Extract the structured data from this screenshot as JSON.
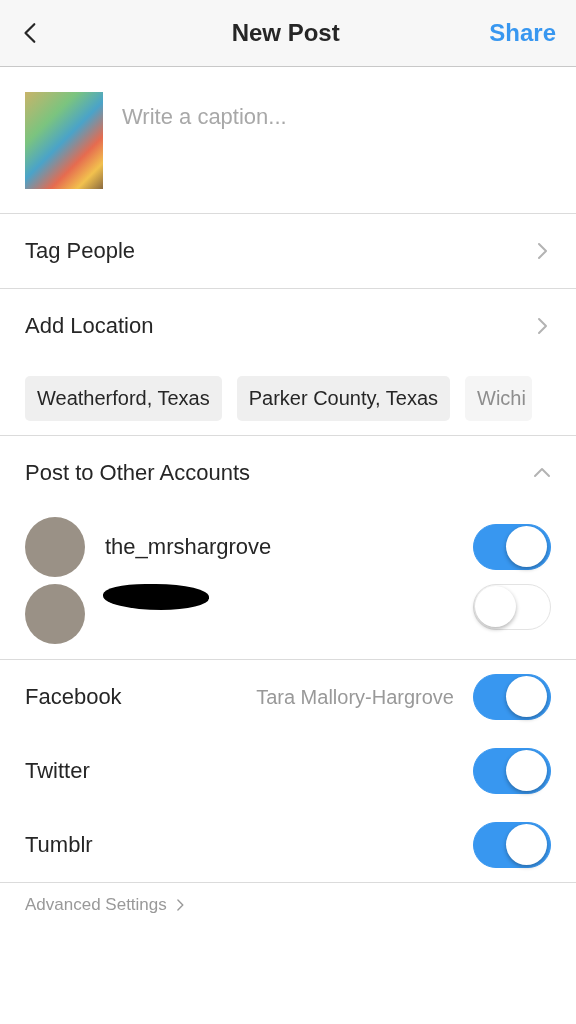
{
  "header": {
    "title": "New Post",
    "action": "Share"
  },
  "caption": {
    "placeholder": "Write a caption..."
  },
  "rows": [
    {
      "label": "Tag People"
    },
    {
      "label": "Add Location"
    }
  ],
  "location_suggestions": [
    {
      "label": "Weatherford, Texas"
    },
    {
      "label": "Parker County, Texas"
    },
    {
      "label": "Wichi"
    }
  ],
  "other_accounts": {
    "title": "Post to Other Accounts",
    "expanded": true,
    "accounts": [
      {
        "kind": "named",
        "username": "the_mrshargrove",
        "on": true
      },
      {
        "kind": "redacted",
        "on": false
      }
    ]
  },
  "share_targets": [
    {
      "name": "Facebook",
      "account": "Tara Mallory-Hargrove",
      "on": true
    },
    {
      "name": "Twitter",
      "on": true
    },
    {
      "name": "Tumblr",
      "on": true
    }
  ],
  "advanced": "Advanced Settings"
}
